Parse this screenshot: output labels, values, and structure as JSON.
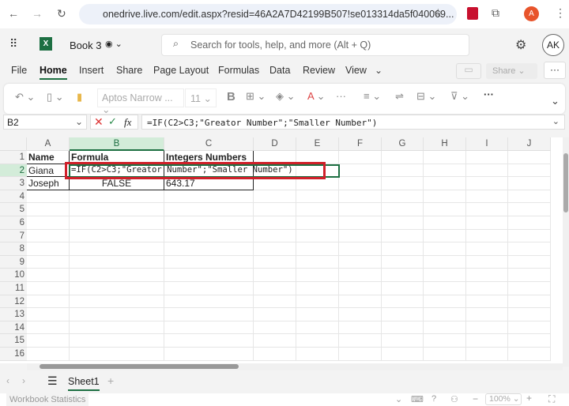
{
  "browser": {
    "url": "onedrive.live.com/edit.aspx?resid=46A2A7D42199B507!se013314da5f040069...",
    "profile": "A"
  },
  "app": {
    "title": "Book 3",
    "search_placeholder": "Search for tools, help, and more (Alt + Q)",
    "user": "AK",
    "brand_color": "#1d6f42"
  },
  "tabs": [
    "File",
    "Home",
    "Insert",
    "Share",
    "Page Layout",
    "Formulas",
    "Data",
    "Review",
    "View"
  ],
  "active_tab": "Home",
  "share_label": "Share",
  "ribbon": {
    "font": "Aptos Narrow ...",
    "size": "11",
    "bold": "B"
  },
  "formula_bar": {
    "name_box": "B2",
    "fx": "fx",
    "formula": "=IF(C2>C3;\"Greator Number\";\"Smaller Number\")"
  },
  "columns": [
    "A",
    "B",
    "C",
    "D",
    "E",
    "F",
    "G",
    "H",
    "I",
    "J"
  ],
  "rows": [
    "1",
    "2",
    "3",
    "4",
    "5",
    "6",
    "7",
    "8",
    "9",
    "10",
    "11",
    "12",
    "13",
    "14",
    "15",
    "16"
  ],
  "cells": {
    "A1": "Name",
    "B1": "Formula",
    "C1": "Integers Numbers",
    "A2": "Giana",
    "B2": "=IF(C2>C3;\"Greator Number\";\"Smaller Number\")",
    "A3": "Joseph",
    "B3": "FALSE",
    "C3": "643.17"
  },
  "sheet": {
    "name": "Sheet1",
    "add": "+"
  },
  "status": {
    "label": "Workbook Statistics",
    "zoom": "100%"
  }
}
